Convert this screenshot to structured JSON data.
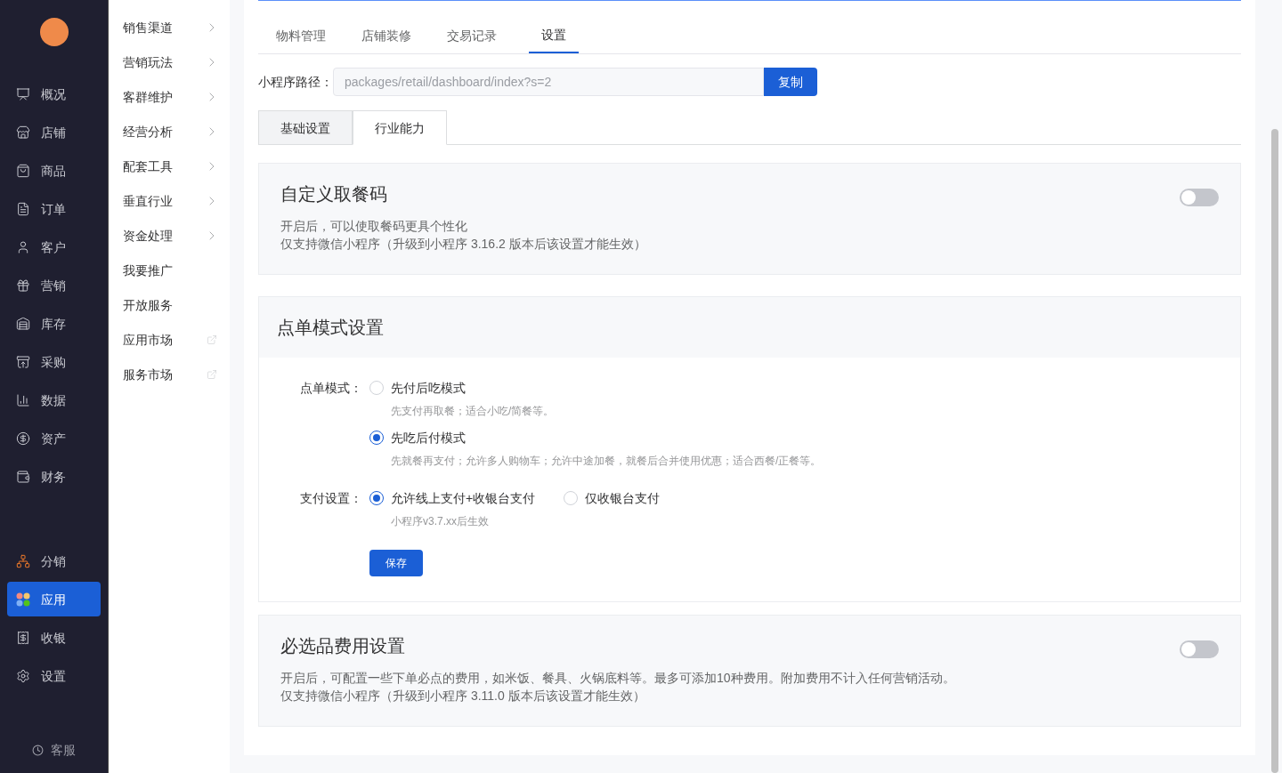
{
  "nav": {
    "groups": [
      [
        {
          "label": "概况",
          "selected": false
        },
        {
          "label": "店铺",
          "selected": false
        },
        {
          "label": "商品",
          "selected": false
        },
        {
          "label": "订单",
          "selected": false
        },
        {
          "label": "客户",
          "selected": false
        },
        {
          "label": "营销",
          "selected": false
        },
        {
          "label": "库存",
          "selected": false
        },
        {
          "label": "采购",
          "selected": false
        },
        {
          "label": "数据",
          "selected": false
        },
        {
          "label": "资产",
          "selected": false
        },
        {
          "label": "财务",
          "selected": false
        }
      ],
      [
        {
          "label": "分销",
          "selected": false
        },
        {
          "label": "应用",
          "selected": true
        },
        {
          "label": "收银",
          "selected": false
        },
        {
          "label": "设置",
          "selected": false
        }
      ]
    ],
    "support": "客服"
  },
  "submenu": [
    {
      "label": "销售渠道",
      "kind": "expand"
    },
    {
      "label": "营销玩法",
      "kind": "expand"
    },
    {
      "label": "客群维护",
      "kind": "expand"
    },
    {
      "label": "经营分析",
      "kind": "expand"
    },
    {
      "label": "配套工具",
      "kind": "expand"
    },
    {
      "label": "垂直行业",
      "kind": "expand"
    },
    {
      "label": "资金处理",
      "kind": "expand"
    },
    {
      "label": "我要推广",
      "kind": "plain"
    },
    {
      "label": "开放服务",
      "kind": "plain"
    },
    {
      "label": "应用市场",
      "kind": "external"
    },
    {
      "label": "服务市场",
      "kind": "external"
    }
  ],
  "tabs": [
    {
      "label": "物料管理",
      "selected": false
    },
    {
      "label": "店铺装修",
      "selected": false
    },
    {
      "label": "交易记录",
      "selected": false
    },
    {
      "label": "设置",
      "selected": true
    }
  ],
  "path": {
    "label": "小程序路径：",
    "value": "packages/retail/dashboard/index?s=2",
    "button": "复制"
  },
  "subtabs": [
    {
      "label": "基础设置",
      "selected": false
    },
    {
      "label": "行业能力",
      "selected": true
    }
  ],
  "custom_code": {
    "title": "自定义取餐码",
    "on": false,
    "lines": [
      "开启后，可以使取餐码更具个性化",
      "仅支持微信小程序（升级到小程序 3.16.2 版本后该设置才能生效）"
    ]
  },
  "order_mode": {
    "title": "点单模式设置",
    "mode": {
      "label": "点单模式：",
      "options": [
        {
          "label": "先付后吃模式",
          "selected": false,
          "hint": "先支付再取餐；适合小吃/简餐等。"
        },
        {
          "label": "先吃后付模式",
          "selected": true,
          "hint": "先就餐再支付；允许多人购物车；允许中途加餐，就餐后合并使用优惠；适合西餐/正餐等。"
        }
      ]
    },
    "payment": {
      "label": "支付设置：",
      "options": [
        {
          "label": "允许线上支付+收银台支付",
          "selected": true
        },
        {
          "label": "仅收银台支付",
          "selected": false
        }
      ],
      "hint": "小程序v3.7.xx后生效"
    },
    "save": "保存"
  },
  "required_fee": {
    "title": "必选品费用设置",
    "on": false,
    "lines": [
      "开启后，可配置一些下单必点的费用，如米饭、餐具、火锅底料等。最多可添加10种费用。附加费用不计入任何营销活动。",
      "仅支持微信小程序（升级到小程序 3.11.0 版本后该设置才能生效）"
    ]
  }
}
